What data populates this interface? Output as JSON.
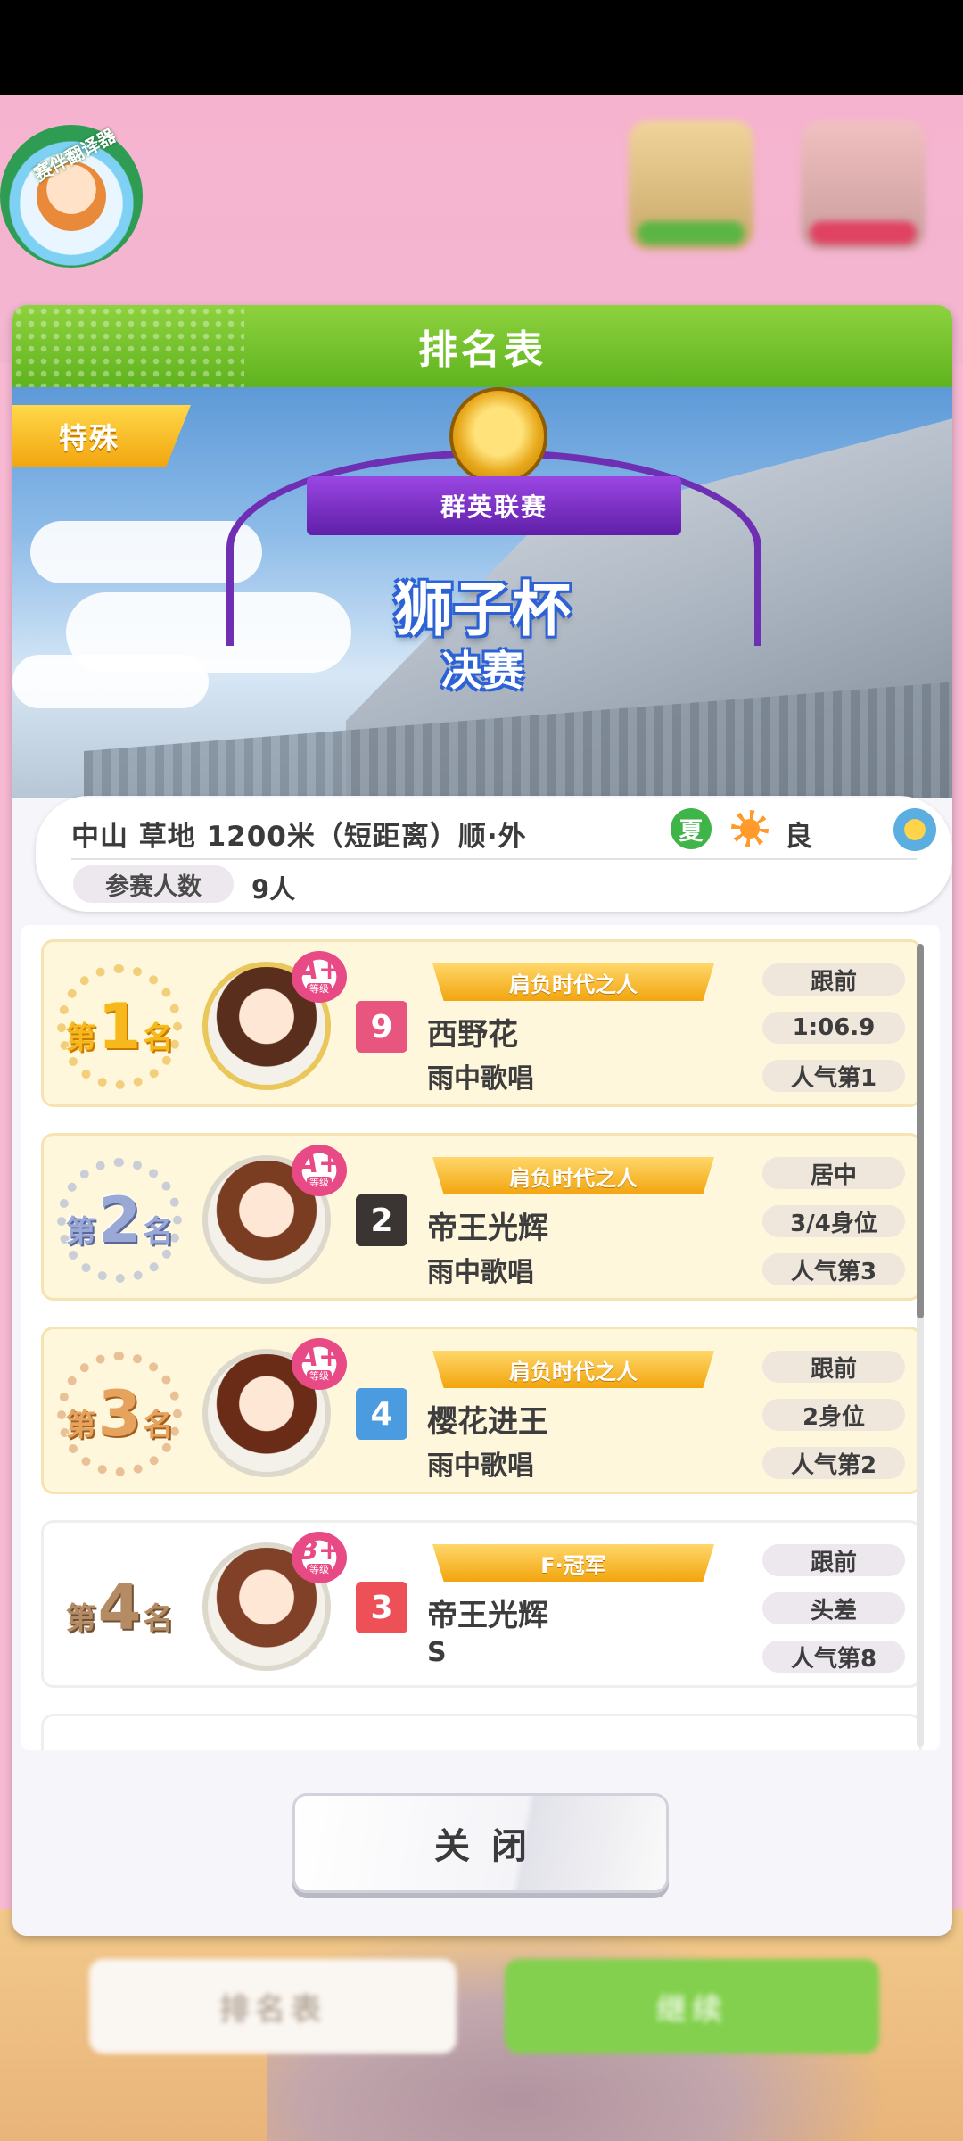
{
  "event_badge": {
    "label": "赛伴翻译器"
  },
  "dialog": {
    "title": "排名表"
  },
  "race": {
    "tag": "特殊",
    "series": "群英联赛",
    "name": "狮子杯",
    "stage": "决赛",
    "info": "中山  草地  1200米（短距离）顺·外",
    "season": "夏",
    "ground": "良",
    "entrants_label": "参赛人数",
    "entrants": "9人"
  },
  "results": [
    {
      "place_prefix": "第",
      "place": "1",
      "place_suffix": "名",
      "medal": "gold",
      "grade": "A+",
      "grade_sub": "等级",
      "number": "9",
      "number_color": "#e8557f",
      "number_text": "#ffffff",
      "title": "肩负时代之人",
      "name": "西野花",
      "trainer": "雨中歌唱",
      "style": "跟前",
      "margin": "1:06.9",
      "popularity": "人气第1"
    },
    {
      "place_prefix": "第",
      "place": "2",
      "place_suffix": "名",
      "medal": "silver",
      "grade": "A+",
      "grade_sub": "等级",
      "number": "2",
      "number_color": "#3a3433",
      "number_text": "#ffffff",
      "title": "肩负时代之人",
      "name": "帝王光辉",
      "trainer": "雨中歌唱",
      "style": "居中",
      "margin": "3/4身位",
      "popularity": "人气第3"
    },
    {
      "place_prefix": "第",
      "place": "3",
      "place_suffix": "名",
      "medal": "bronze",
      "grade": "A+",
      "grade_sub": "等级",
      "number": "4",
      "number_color": "#4a9be0",
      "number_text": "#ffffff",
      "title": "肩负时代之人",
      "name": "樱花进王",
      "trainer": "雨中歌唱",
      "style": "跟前",
      "margin": "2身位",
      "popularity": "人气第2"
    },
    {
      "place_prefix": "第",
      "place": "4",
      "place_suffix": "名",
      "medal": "plain",
      "grade": "B+",
      "grade_sub": "等级",
      "number": "3",
      "number_color": "#ee5058",
      "number_text": "#ffffff",
      "title": "F·冠军",
      "name": "帝王光辉",
      "trainer": "S",
      "style": "跟前",
      "margin": "头差",
      "popularity": "人气第8"
    }
  ],
  "footer": {
    "close_label": "关闭"
  },
  "background_buttons": {
    "left": "排名表",
    "right": "继续"
  }
}
